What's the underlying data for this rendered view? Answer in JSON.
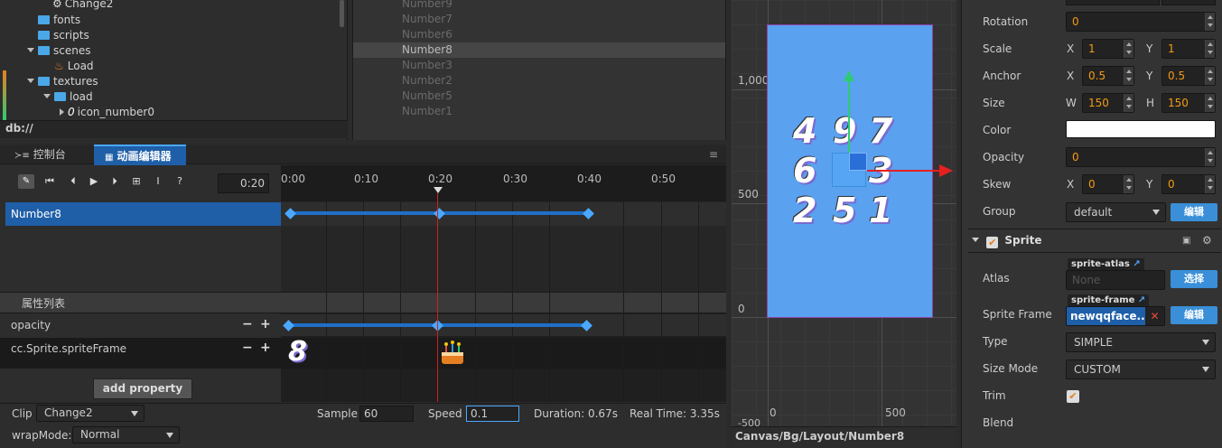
{
  "assets": {
    "items": [
      {
        "label": "Change2",
        "kind": "anim"
      },
      {
        "label": "fonts",
        "kind": "folder"
      },
      {
        "label": "scripts",
        "kind": "folder"
      },
      {
        "label": "scenes",
        "kind": "folder-open"
      },
      {
        "label": "Load",
        "kind": "scene"
      },
      {
        "label": "textures",
        "kind": "folder-open"
      },
      {
        "label": "load",
        "kind": "folder-open"
      },
      {
        "label": "icon_number0",
        "kind": "texture"
      }
    ],
    "footer_path": "db://"
  },
  "hierarchy": {
    "items": [
      "Number9",
      "Number7",
      "Number6",
      "Number8",
      "Number3",
      "Number2",
      "Number5",
      "Number1"
    ],
    "selected": "Number8"
  },
  "bottom_tabs": {
    "console": "控制台",
    "animation": "动画编辑器"
  },
  "timeline": {
    "current_time": "0:20",
    "ticks": [
      "0:00",
      "0:10",
      "0:20",
      "0:30",
      "0:40",
      "0:50"
    ],
    "node_name": "Number8",
    "props_header": "属性列表",
    "properties": [
      "opacity",
      "cc.Sprite.spriteFrame"
    ],
    "add_property": "add property",
    "sprite_frame_first": "8",
    "cake_icon": "cake-icon",
    "clip_label": "Clip",
    "clip_value": "Change2",
    "sample_label": "Sample",
    "sample_value": "60",
    "speed_label": "Speed",
    "speed_value": "0.1",
    "duration": "Duration: 0.67s",
    "realtime": "Real Time: 3.35s",
    "wrapmode_label": "wrapMode:",
    "wrapmode_value": "Normal"
  },
  "scene": {
    "y_labels": [
      "1,000",
      "500",
      "0",
      "-500"
    ],
    "x_labels": [
      "0",
      "500"
    ],
    "digits": [
      "4",
      "9",
      "7",
      "6",
      "3",
      "2",
      "5",
      "1"
    ],
    "canvas_color": "#5aa1ef",
    "path": "Canvas/Bg/Layout/Number8"
  },
  "inspector": {
    "rotation_label": "Rotation",
    "rotation": "0",
    "scale_label": "Scale",
    "scale_x": "1",
    "scale_y": "1",
    "anchor_label": "Anchor",
    "anchor_x": "0.5",
    "anchor_y": "0.5",
    "size_label": "Size",
    "size_w": "150",
    "size_h": "150",
    "color_label": "Color",
    "opacity_label": "Opacity",
    "opacity": "0",
    "skew_label": "Skew",
    "skew_x": "0",
    "skew_y": "0",
    "group_label": "Group",
    "group_value": "default",
    "edit_label": "编辑",
    "sprite_section": "Sprite",
    "atlas_label": "Atlas",
    "atlas_tag": "sprite-atlas",
    "atlas_value": "None",
    "select_label": "选择",
    "sprite_frame_label": "Sprite Frame",
    "sprite_frame_tag": "sprite-frame",
    "sprite_frame_value": "newqqface...",
    "type_label": "Type",
    "type_value": "SIMPLE",
    "size_mode_label": "Size Mode",
    "size_mode_value": "CUSTOM",
    "trim_label": "Trim",
    "blend_label": "Blend",
    "x": "X",
    "y": "Y",
    "w": "W",
    "h": "H"
  }
}
